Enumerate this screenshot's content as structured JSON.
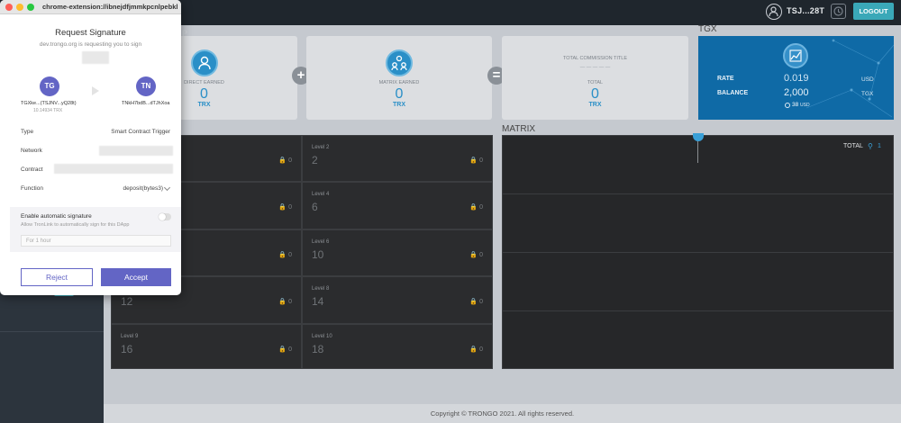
{
  "header": {
    "address": "TSJ...28T",
    "logout_label": "LOGOUT"
  },
  "cards": {
    "direct": {
      "label": "DIRECT EARNED",
      "value": "0",
      "unit": "TRX"
    },
    "matrix": {
      "label": "MATRIX EARNED",
      "value": "0",
      "unit": "TRX"
    },
    "commission": {
      "title": "TOTAL COMMISSION TITLE",
      "dashes": "— — — — —",
      "label": "TOTAL",
      "value": "0",
      "unit": "TRX"
    },
    "plus": "+",
    "equals": "="
  },
  "tgx": {
    "title": "TGX",
    "rate_label": "RATE",
    "rate_value": "0.019",
    "rate_unit": "USD",
    "balance_label": "BALANCE",
    "balance_value": "2,000",
    "balance_unit": "TGX",
    "balance_usd": "38",
    "balance_usd_unit": "USD"
  },
  "sidebar": {
    "peek_p": "P",
    "peek_c": "C"
  },
  "levels": [
    {
      "label": "",
      "value": "",
      "locked": "0"
    },
    {
      "label": "Level 2",
      "value": "2",
      "locked": "0"
    },
    {
      "label": "",
      "value": "",
      "locked": "0"
    },
    {
      "label": "Level 4",
      "value": "6",
      "locked": "0"
    },
    {
      "label": "",
      "value": "",
      "locked": "0"
    },
    {
      "label": "Level 6",
      "value": "10",
      "locked": "0"
    },
    {
      "label": "",
      "value": "12",
      "locked": "0"
    },
    {
      "label": "Level 8",
      "value": "14",
      "locked": "0"
    },
    {
      "label": "Level 9",
      "value": "16",
      "locked": "0"
    },
    {
      "label": "Level 10",
      "value": "18",
      "locked": "0"
    }
  ],
  "matrix_panel": {
    "title": "MATRIX",
    "total_label": "TOTAL",
    "total_value": "1"
  },
  "footer": {
    "text": "Copyright © TRONGO 2021. All rights reserved."
  },
  "popup": {
    "url": "chrome-extension://ibnejdfjmmkpcnlpebkl...",
    "title": "Request Signature",
    "subtitle": "dev.trongo.org is requesting you to sign",
    "from": {
      "initials": "TG",
      "address": "TGXke...(TSJNV...yQ28t)",
      "balance": "10.14934 TRX"
    },
    "to": {
      "initials": "TN",
      "address": "TNkH7bdB...dTJhXoa"
    },
    "type_label": "Type",
    "type_value": "Smart Contract Trigger",
    "network_label": "Network",
    "contract_label": "Contract",
    "function_label": "Function",
    "function_value": "deposit(bytes3)",
    "auto_title": "Enable automatic signature",
    "auto_desc": "Allow TronLink to automatically sign for this DApp",
    "duration": "For 1 hour",
    "reject_label": "Reject",
    "accept_label": "Accept"
  }
}
